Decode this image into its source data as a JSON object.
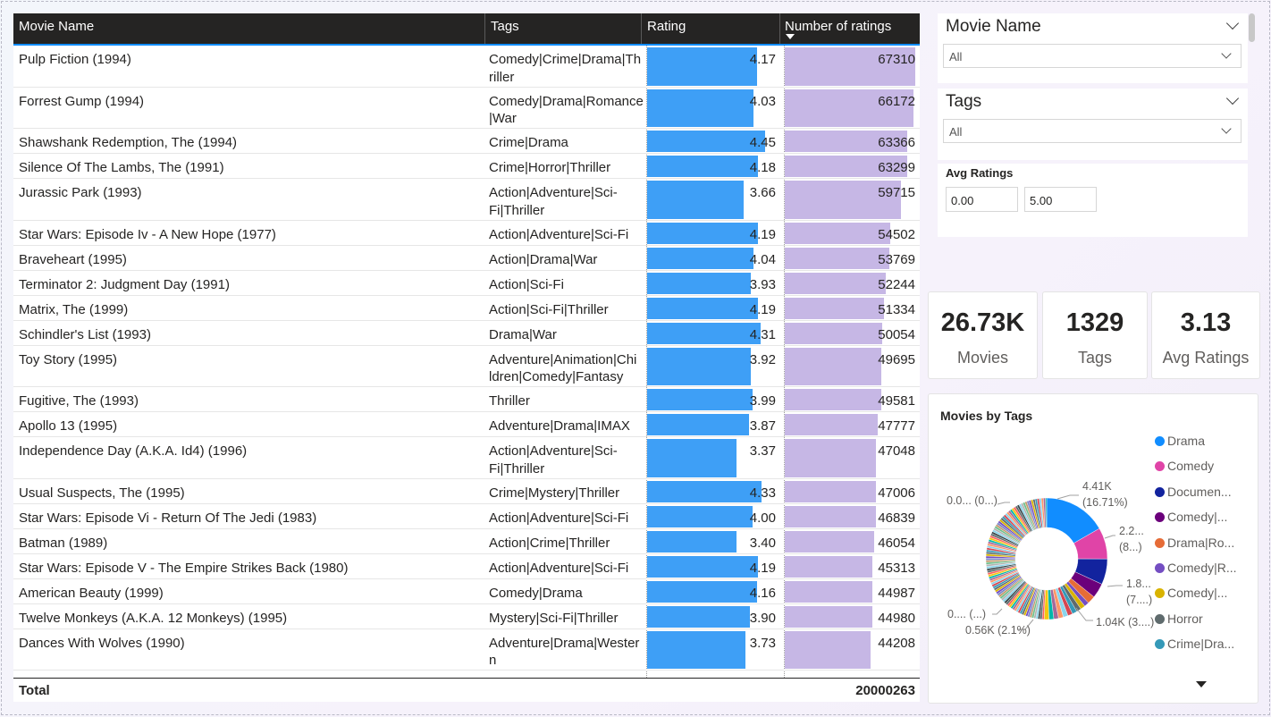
{
  "table": {
    "columns": [
      "Movie Name",
      "Tags",
      "Rating",
      "Number of ratings"
    ],
    "rows": [
      {
        "name": "Pulp Fiction (1994)",
        "tags": "Comedy|Crime|Drama|Th riller",
        "rating": "4.17",
        "count": "67310",
        "lines": 2
      },
      {
        "name": "Forrest Gump (1994)",
        "tags": "Comedy|Drama|Romance |War",
        "rating": "4.03",
        "count": "66172",
        "lines": 2
      },
      {
        "name": "Shawshank Redemption, The (1994)",
        "tags": "Crime|Drama",
        "rating": "4.45",
        "count": "63366",
        "lines": 1
      },
      {
        "name": "Silence Of The Lambs, The (1991)",
        "tags": "Crime|Horror|Thriller",
        "rating": "4.18",
        "count": "63299",
        "lines": 1
      },
      {
        "name": "Jurassic Park (1993)",
        "tags": "Action|Adventure|Sci- Fi|Thriller",
        "rating": "3.66",
        "count": "59715",
        "lines": 2
      },
      {
        "name": "Star Wars: Episode Iv - A New Hope (1977)",
        "tags": "Action|Adventure|Sci-Fi",
        "rating": "4.19",
        "count": "54502",
        "lines": 1
      },
      {
        "name": "Braveheart (1995)",
        "tags": "Action|Drama|War",
        "rating": "4.04",
        "count": "53769",
        "lines": 1
      },
      {
        "name": "Terminator 2: Judgment Day (1991)",
        "tags": "Action|Sci-Fi",
        "rating": "3.93",
        "count": "52244",
        "lines": 1
      },
      {
        "name": "Matrix, The (1999)",
        "tags": "Action|Sci-Fi|Thriller",
        "rating": "4.19",
        "count": "51334",
        "lines": 1
      },
      {
        "name": "Schindler's List (1993)",
        "tags": "Drama|War",
        "rating": "4.31",
        "count": "50054",
        "lines": 1
      },
      {
        "name": "Toy Story (1995)",
        "tags": "Adventure|Animation|Chi ldren|Comedy|Fantasy",
        "rating": "3.92",
        "count": "49695",
        "lines": 2
      },
      {
        "name": "Fugitive, The (1993)",
        "tags": "Thriller",
        "rating": "3.99",
        "count": "49581",
        "lines": 1
      },
      {
        "name": "Apollo 13 (1995)",
        "tags": "Adventure|Drama|IMAX",
        "rating": "3.87",
        "count": "47777",
        "lines": 1
      },
      {
        "name": "Independence Day (A.K.A. Id4) (1996)",
        "tags": "Action|Adventure|Sci- Fi|Thriller",
        "rating": "3.37",
        "count": "47048",
        "lines": 2
      },
      {
        "name": "Usual Suspects, The (1995)",
        "tags": "Crime|Mystery|Thriller",
        "rating": "4.33",
        "count": "47006",
        "lines": 1
      },
      {
        "name": "Star Wars: Episode Vi - Return Of The Jedi (1983)",
        "tags": "Action|Adventure|Sci-Fi",
        "rating": "4.00",
        "count": "46839",
        "lines": 1
      },
      {
        "name": "Batman (1989)",
        "tags": "Action|Crime|Thriller",
        "rating": "3.40",
        "count": "46054",
        "lines": 1
      },
      {
        "name": "Star Wars: Episode V - The Empire Strikes Back (1980)",
        "tags": "Action|Adventure|Sci-Fi",
        "rating": "4.19",
        "count": "45313",
        "lines": 1
      },
      {
        "name": "American Beauty (1999)",
        "tags": "Comedy|Drama",
        "rating": "4.16",
        "count": "44987",
        "lines": 1
      },
      {
        "name": "Twelve Monkeys (A.K.A. 12 Monkeys) (1995)",
        "tags": "Mystery|Sci-Fi|Thriller",
        "rating": "3.90",
        "count": "44980",
        "lines": 1
      },
      {
        "name": "Dances With Wolves (1990)",
        "tags": "Adventure|Drama|Wester n",
        "rating": "3.73",
        "count": "44208",
        "lines": 2
      }
    ],
    "total_label": "Total",
    "total_value": "20000263",
    "rating_max": 4.5,
    "count_max": 67310
  },
  "slicers": {
    "movie": {
      "title": "Movie Name",
      "value": "All"
    },
    "tags": {
      "title": "Tags",
      "value": "All"
    },
    "avg": {
      "title": "Avg Ratings",
      "min": "0.00",
      "max": "5.00"
    }
  },
  "kpis": [
    {
      "value": "26.73K",
      "label": "Movies"
    },
    {
      "value": "1329",
      "label": "Tags"
    },
    {
      "value": "3.13",
      "label": "Avg Ratings"
    }
  ],
  "chart_data": {
    "type": "pie",
    "title": "Movies by Tags",
    "legend_position": "right",
    "categories": [
      "Drama",
      "Comedy",
      "Documen...",
      "Comedy|...",
      "Drama|Ro...",
      "Comedy|R...",
      "Comedy|...",
      "Horror",
      "Crime|Dra..."
    ],
    "values": [
      4410,
      2200,
      1800,
      1040,
      560
    ],
    "percentages": [
      16.71,
      null,
      null,
      null,
      2.1
    ],
    "colors": [
      "#118dff",
      "#e044a7",
      "#12239e",
      "#6b007b",
      "#e66c37",
      "#744ec2",
      "#d9b300",
      "#5f6b6d",
      "#3599b8"
    ],
    "data_labels": [
      {
        "text": "4.41K",
        "sub": "(16.71%)"
      },
      {
        "text": "2.2...",
        "sub": "(8...)"
      },
      {
        "text": "1.8...",
        "sub": "(7....)"
      },
      {
        "text": "1.04K (3....)",
        "sub": ""
      },
      {
        "text": "0.56K (2.1%)",
        "sub": ""
      },
      {
        "text": "0.... (...)",
        "sub": ""
      },
      {
        "text": "0.0... (0...)",
        "sub": ""
      }
    ]
  },
  "colors": {
    "rating_bar": "#3e9ff6",
    "count_bar": "#c6b7e5",
    "header_bg": "#252423"
  }
}
